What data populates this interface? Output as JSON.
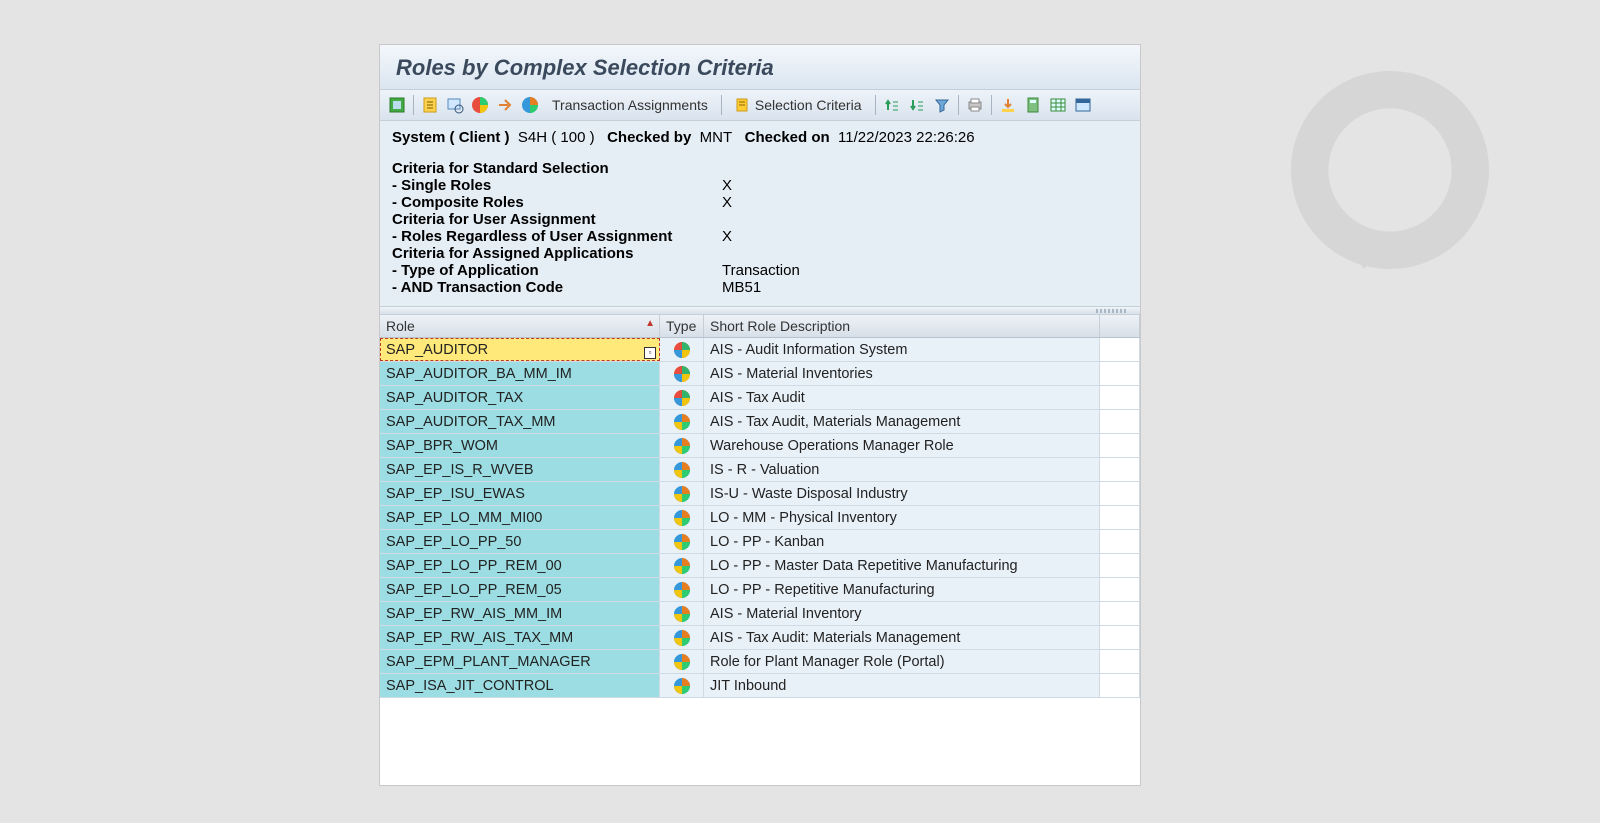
{
  "title": "Roles by Complex Selection Criteria",
  "toolbar": {
    "transaction_assignments": "Transaction Assignments",
    "selection_criteria": "Selection Criteria"
  },
  "sys": {
    "label_system": "System ( Client )",
    "system": "S4H ( 100 )",
    "label_checked_by": "Checked by",
    "checked_by": "MNT",
    "label_checked_on": "Checked on",
    "checked_on": "11/22/2023 22:26:26"
  },
  "criteria": [
    {
      "k": "Criteria for Standard Selection",
      "v": "",
      "head": true
    },
    {
      "k": "- Single Roles",
      "v": "X"
    },
    {
      "k": "- Composite Roles",
      "v": "X"
    },
    {
      "k": "Criteria for User Assignment",
      "v": "",
      "head": true
    },
    {
      "k": "- Roles Regardless of User Assignment",
      "v": "X"
    },
    {
      "k": "Criteria for Assigned Applications",
      "v": "",
      "head": true
    },
    {
      "k": "- Type of Application",
      "v": "Transaction"
    },
    {
      "k": "- AND Transaction Code",
      "v": "MB51"
    }
  ],
  "columns": {
    "role": "Role",
    "type": "Type",
    "desc": "Short Role Description"
  },
  "rows": [
    {
      "role": "SAP_AUDITOR",
      "pie": "a",
      "desc": "AIS - Audit Information System",
      "selected": true
    },
    {
      "role": "SAP_AUDITOR_BA_MM_IM",
      "pie": "a",
      "desc": "AIS - Material Inventories"
    },
    {
      "role": "SAP_AUDITOR_TAX",
      "pie": "a",
      "desc": "AIS - Tax Audit"
    },
    {
      "role": "SAP_AUDITOR_TAX_MM",
      "pie": "b",
      "desc": "AIS - Tax Audit, Materials Management"
    },
    {
      "role": "SAP_BPR_WOM",
      "pie": "b",
      "desc": "Warehouse Operations Manager Role"
    },
    {
      "role": "SAP_EP_IS_R_WVEB",
      "pie": "b",
      "desc": "IS - R - Valuation"
    },
    {
      "role": "SAP_EP_ISU_EWAS",
      "pie": "b",
      "desc": "IS-U - Waste Disposal Industry"
    },
    {
      "role": "SAP_EP_LO_MM_MI00",
      "pie": "b",
      "desc": "LO - MM - Physical Inventory"
    },
    {
      "role": "SAP_EP_LO_PP_50",
      "pie": "b",
      "desc": "LO - PP - Kanban"
    },
    {
      "role": "SAP_EP_LO_PP_REM_00",
      "pie": "b",
      "desc": "LO - PP - Master Data Repetitive Manufacturing"
    },
    {
      "role": "SAP_EP_LO_PP_REM_05",
      "pie": "b",
      "desc": "LO - PP - Repetitive Manufacturing"
    },
    {
      "role": "SAP_EP_RW_AIS_MM_IM",
      "pie": "b",
      "desc": "AIS - Material Inventory"
    },
    {
      "role": "SAP_EP_RW_AIS_TAX_MM",
      "pie": "b",
      "desc": "AIS - Tax Audit: Materials Management"
    },
    {
      "role": "SAP_EPM_PLANT_MANAGER",
      "pie": "b",
      "desc": "Role for Plant Manager Role (Portal)"
    },
    {
      "role": "SAP_ISA_JIT_CONTROL",
      "pie": "b",
      "desc": "JIT Inbound"
    }
  ]
}
